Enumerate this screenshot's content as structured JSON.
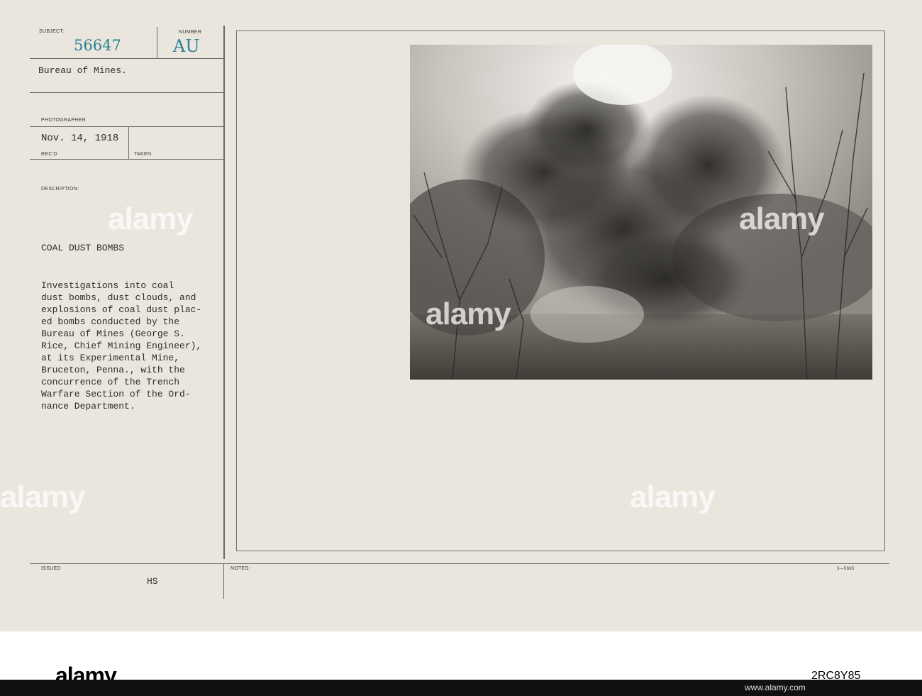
{
  "card": {
    "subject_label": "SUBJECT:",
    "subject_number": "56647",
    "number_label": "NUMBER",
    "number_code": "AU",
    "bureau": "Bureau of Mines.",
    "photographer_label": "PHOTOGRAPHER",
    "date": "Nov. 14, 1918",
    "recd_label": "REC'D",
    "taken_label": "TAKEN",
    "description_label": "DESCRIPTION:",
    "title": "COAL DUST BOMBS",
    "description_lines": [
      "Investigations into coal",
      "dust bombs, dust clouds, and",
      "explosions of coal dust plac-",
      "ed bombs conducted by the",
      "Bureau of Mines (George S.",
      "Rice, Chief Mining Engineer),",
      "at its Experimental Mine,",
      "Bruceton, Penna., with the",
      "concurrence of the Trench",
      "Warfare Section of the Ord-",
      "nance Department."
    ],
    "issued_label": "ISSUED",
    "issued_initials": "HS",
    "notes_label": "NOTES:",
    "form_number": "3—5665"
  },
  "watermark": "alamy",
  "footer": {
    "logo": "alamy",
    "image_id_top": "2RC8Y85",
    "image_id_bottom": "www.alamy.com"
  }
}
